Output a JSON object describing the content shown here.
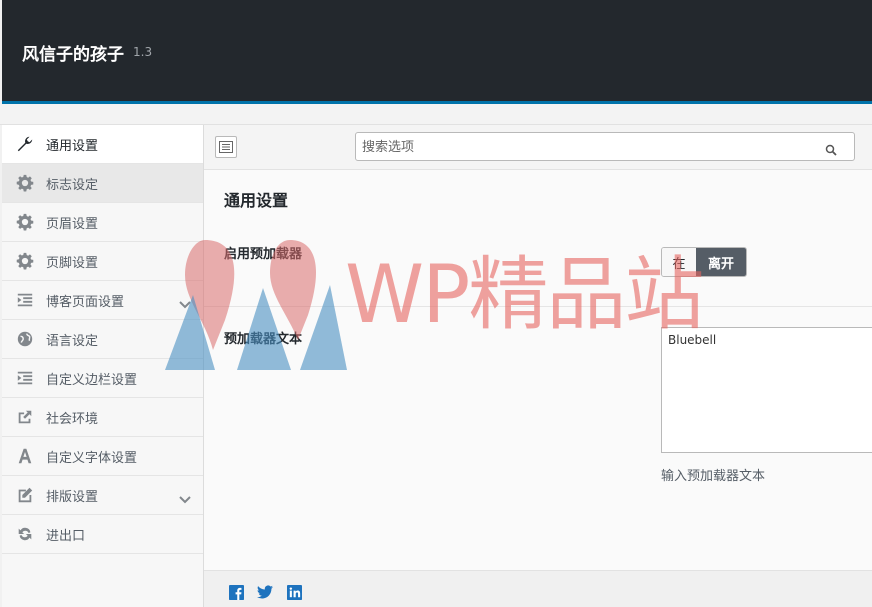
{
  "header": {
    "title": "风信子的孩子",
    "version": "1.3"
  },
  "sidebar": {
    "items": [
      {
        "label": "通用设置",
        "icon": "wrench-icon"
      },
      {
        "label": "标志设定",
        "icon": "gear-icon"
      },
      {
        "label": "页眉设置",
        "icon": "gear-icon"
      },
      {
        "label": "页脚设置",
        "icon": "gear-icon"
      },
      {
        "label": "博客页面设置",
        "icon": "indent-icon"
      },
      {
        "label": "语言设定",
        "icon": "globe-icon"
      },
      {
        "label": "自定义边栏设置",
        "icon": "indent-icon"
      },
      {
        "label": "社会环境",
        "icon": "share-icon"
      },
      {
        "label": "自定义字体设置",
        "icon": "font-icon"
      },
      {
        "label": "排版设置",
        "icon": "edit-icon"
      },
      {
        "label": "进出口",
        "icon": "refresh-icon"
      }
    ]
  },
  "search": {
    "placeholder": "搜索选项"
  },
  "section": {
    "title": "通用设置"
  },
  "fields": {
    "preloader": {
      "label": "启用预加载器",
      "on_label": "在",
      "off_label": "离开"
    },
    "preloader_text": {
      "label": "预加载器文本",
      "value": "Bluebell",
      "description": "输入预加载器文本"
    }
  },
  "watermark": {
    "text": "WP精品站"
  },
  "colors": {
    "header_bg": "#23282d",
    "accent": "#0073aa",
    "facebook": "#3b5998",
    "twitter": "#1da1f2",
    "linkedin": "#0077b5"
  }
}
